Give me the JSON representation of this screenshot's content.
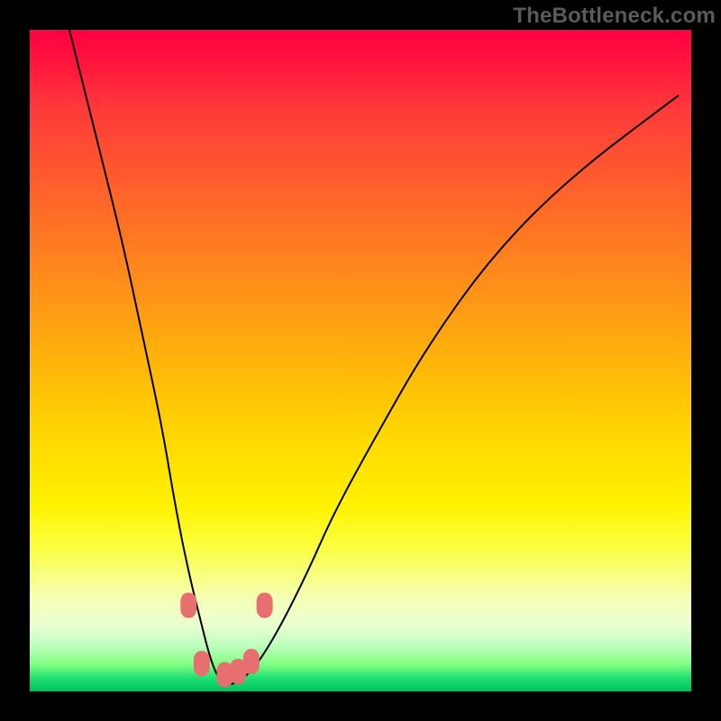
{
  "watermark": "TheBottleneck.com",
  "colors": {
    "frame_bg": "#000000",
    "curve_stroke": "#000000",
    "marker_fill": "#e76f6f",
    "watermark_text": "#5a5a5a"
  },
  "chart_data": {
    "type": "line",
    "title": "",
    "xlabel": "",
    "ylabel": "",
    "xlim": [
      0,
      100
    ],
    "ylim": [
      0,
      100
    ],
    "grid": false,
    "legend": false,
    "series": [
      {
        "name": "bottleneck-curve",
        "x": [
          6,
          10,
          14,
          17,
          20,
          22,
          24,
          26,
          27,
          28,
          29,
          30,
          31,
          33,
          35,
          38,
          42,
          46,
          52,
          60,
          70,
          82,
          98
        ],
        "values": [
          100,
          84,
          68,
          54,
          40,
          28,
          18,
          10,
          6,
          3,
          1.5,
          1,
          1.2,
          2.5,
          5,
          10,
          18,
          27,
          38,
          52,
          66,
          78,
          90
        ]
      }
    ],
    "markers": [
      {
        "x": 24.0,
        "y": 13.0
      },
      {
        "x": 26.0,
        "y": 4.2
      },
      {
        "x": 29.5,
        "y": 2.5
      },
      {
        "x": 31.5,
        "y": 3.0
      },
      {
        "x": 33.5,
        "y": 4.5
      },
      {
        "x": 35.5,
        "y": 13.0
      }
    ],
    "green_band_y": [
      0,
      5
    ]
  }
}
